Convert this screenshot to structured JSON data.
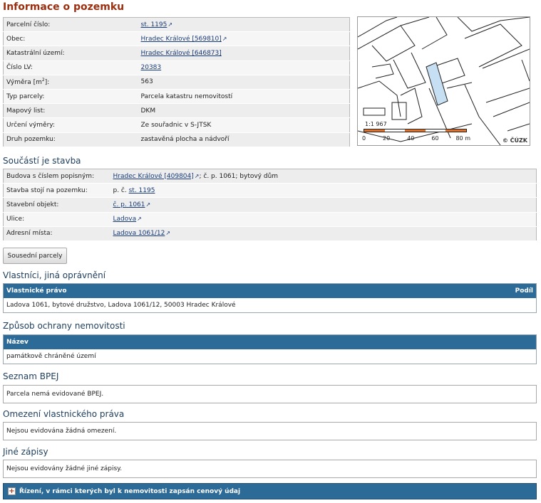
{
  "parcel": {
    "title": "Informace o pozemku",
    "rows": [
      {
        "label": "Parcelní číslo:",
        "value": "st. 1195",
        "link": true
      },
      {
        "label": "Obec:",
        "value": "Hradec Králové [569810]",
        "link": true
      },
      {
        "label": "Katastrální území:",
        "value": "Hradec Králové [646873]",
        "link": true
      },
      {
        "label": "Číslo LV:",
        "value": "20383",
        "link": true
      },
      {
        "label": "Výměra [m",
        "label_sup": "2",
        "label_tail": "]:",
        "value": "563"
      },
      {
        "label": "Typ parcely:",
        "value": "Parcela katastru nemovitostí"
      },
      {
        "label": "Mapový list:",
        "value": "DKM"
      },
      {
        "label": "Určení výměry:",
        "value": "Ze souřadnic v S-JTSK"
      },
      {
        "label": "Druh pozemku:",
        "value": "zastavěná plocha a nádvoří"
      }
    ]
  },
  "map": {
    "scale_text": "1:1 967",
    "scale_ticks": [
      "0",
      "20",
      "40",
      "60",
      "80 m"
    ],
    "copyright": "© ČÚZK",
    "highlight_color": "#c6dff2",
    "scale_color": "#e0722c"
  },
  "building": {
    "title": "Součástí je stavba",
    "rows": [
      {
        "label": "Budova s číslem popisným:",
        "link": "Hradec Králové [409804]",
        "suffix": "; č. p. 1061; bytový dům"
      },
      {
        "label": "Stavba stojí na pozemku:",
        "prefix": "p. č. ",
        "link": "st. 1195"
      },
      {
        "label": "Stavební objekt:",
        "link": "č. p. 1061"
      },
      {
        "label": "Ulice:",
        "link": "Ladova"
      },
      {
        "label": "Adresní místa:",
        "link": "Ladova 1061/12"
      }
    ]
  },
  "neighbors_button": "Sousední parcely",
  "owners": {
    "title": "Vlastníci, jiná oprávnění",
    "col1": "Vlastnické právo",
    "col2": "Podíl",
    "row": "Ladova 1061, bytové družstvo, Ladova 1061/12, 50003 Hradec Králové"
  },
  "protection": {
    "title": "Způsob ochrany nemovitosti",
    "col": "Název",
    "row": "památkově chráněné území"
  },
  "bpej": {
    "title": "Seznam BPEJ",
    "text": "Parcela nemá evidované BPEJ."
  },
  "restrictions": {
    "title": "Omezení vlastnického práva",
    "text": "Nejsou evidována žádná omezení."
  },
  "other": {
    "title": "Jiné zápisy",
    "text": "Nejsou evidovány žádné jiné zápisy."
  },
  "price_bar": {
    "icon": "plus-icon",
    "text": "Řízení, v rámci kterých byl k nemovitosti zapsán cenový údaj"
  },
  "colors": {
    "header_blue": "#2c6a97",
    "title_red": "#9b2e0e",
    "link": "#1a3c78"
  }
}
